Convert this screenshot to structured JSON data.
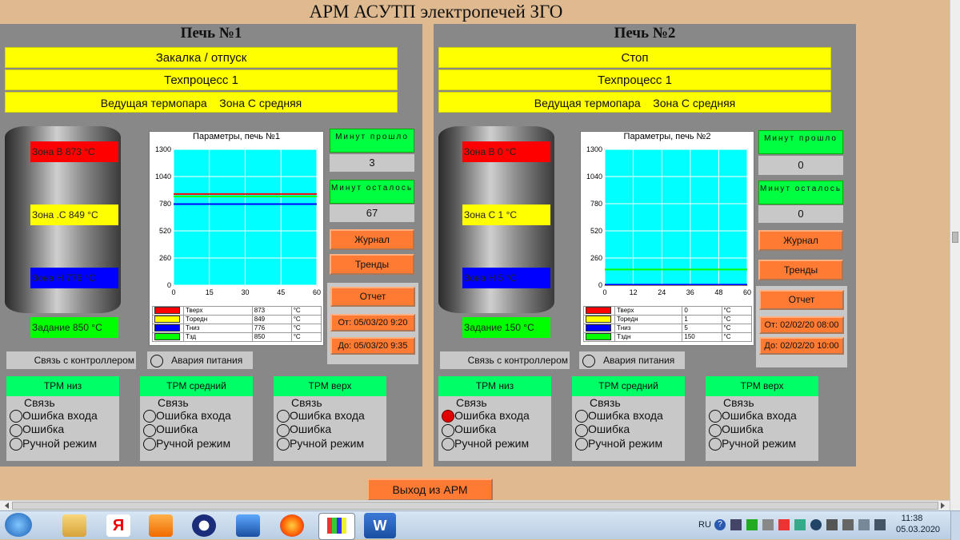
{
  "title": "АРМ АСУТП электропечей ЗГО",
  "furnace1": {
    "title": "Печь №1",
    "mode": "Закалка / отпуск",
    "process": "Техпроцесс 1",
    "thermocouple_label": "Ведущая термопара",
    "thermocouple_zone": "Зона С средняя",
    "zone_b": "Зона В   873 °С",
    "zone_c": "Зона .С   849 °С",
    "zone_n": "Зона Н   776 °С",
    "setpoint": "Задание   850 °С",
    "chart_title": "Параметры, печь №1",
    "minutes_passed_label": "Минут прошло",
    "minutes_passed": "3",
    "minutes_left_label": "Минут осталось",
    "minutes_left": "67",
    "journal": "Журнал",
    "trends": "Тренды",
    "report": "Отчет",
    "from": "От:  05/03/20 9:20",
    "to": "До:  05/03/20 9:35",
    "link": "Связь с контроллером",
    "power_alarm": "Авария питания",
    "legend": [
      {
        "name": "Тверх",
        "value": "873",
        "unit": "°С",
        "color": "#ff0000"
      },
      {
        "name": "Тoредн",
        "value": "849",
        "unit": "°С",
        "color": "#ffff00"
      },
      {
        "name": "Тниз",
        "value": "776",
        "unit": "°С",
        "color": "#0000ff"
      },
      {
        "name": "Тзд",
        "value": "850",
        "unit": "°С",
        "color": "#00ff00"
      }
    ]
  },
  "furnace2": {
    "title": "Печь №2",
    "mode": "Стоп",
    "process": "Техпроцесс 1",
    "thermocouple_label": "Ведущая термопара",
    "thermocouple_zone": "Зона С средняя",
    "zone_b": "Зона В   0 °С",
    "zone_c": "Зона С   1 °С",
    "zone_n": "Зона Н   5 °С",
    "setpoint": "Задание   150 °С",
    "chart_title": "Параметры, печь №2",
    "minutes_passed_label": "Минут прошло",
    "minutes_passed": "0",
    "minutes_left_label": "Минут осталось",
    "minutes_left": "0",
    "journal": "Журнал",
    "trends": "Тренды",
    "report": "Отчет",
    "from": "От:  02/02/20 08:00",
    "to": "До:  02/02/20 10:00",
    "link": "Связь с контроллером",
    "power_alarm": "Авария питания",
    "legend": [
      {
        "name": "Тверх",
        "value": "0",
        "unit": "°С",
        "color": "#ff0000"
      },
      {
        "name": "Торедн",
        "value": "1",
        "unit": "°С",
        "color": "#ffff00"
      },
      {
        "name": "Тниз",
        "value": "5",
        "unit": "°С",
        "color": "#0000ff"
      },
      {
        "name": "Тздн",
        "value": "150",
        "unit": "°С",
        "color": "#00ff00"
      }
    ]
  },
  "trm_labels": {
    "low": "ТРМ низ",
    "mid": "ТРМ средний",
    "top": "ТРМ верх",
    "link": "Связь",
    "input_error": "Ошибка входа",
    "error": "Ошибка",
    "manual": "Ручной режим"
  },
  "exit": "Выход из АРМ",
  "tray": {
    "lang": "RU",
    "time": "11:38",
    "date": "05.03.2020"
  },
  "chart_data": [
    {
      "type": "line",
      "title": "Параметры, печь №1",
      "x_ticks": [
        0,
        15,
        30,
        45,
        60
      ],
      "y_ticks": [
        0,
        260,
        520,
        780,
        1040,
        1300
      ],
      "xlim": [
        0,
        60
      ],
      "ylim": [
        0,
        1300
      ],
      "series": [
        {
          "name": "Тверх",
          "color": "#ff0000",
          "x": [
            0,
            60
          ],
          "y": [
            873,
            873
          ]
        },
        {
          "name": "Тoредн",
          "color": "#ffff00",
          "x": [
            0,
            60
          ],
          "y": [
            849,
            849
          ]
        },
        {
          "name": "Тниз",
          "color": "#0000ff",
          "x": [
            0,
            60
          ],
          "y": [
            776,
            776
          ]
        },
        {
          "name": "Тзд",
          "color": "#00ff00",
          "x": [
            0,
            60
          ],
          "y": [
            850,
            850
          ]
        }
      ]
    },
    {
      "type": "line",
      "title": "Параметры, печь №2",
      "x_ticks": [
        0,
        12,
        24,
        36,
        48,
        60
      ],
      "y_ticks": [
        0,
        260,
        520,
        780,
        1040,
        1300
      ],
      "xlim": [
        0,
        60
      ],
      "ylim": [
        0,
        1300
      ],
      "series": [
        {
          "name": "Тверх",
          "color": "#ff0000",
          "x": [
            0,
            60
          ],
          "y": [
            0,
            0
          ]
        },
        {
          "name": "Торедн",
          "color": "#ffff00",
          "x": [
            0,
            60
          ],
          "y": [
            1,
            1
          ]
        },
        {
          "name": "Тниз",
          "color": "#0000ff",
          "x": [
            0,
            60
          ],
          "y": [
            5,
            5
          ]
        },
        {
          "name": "Тздн",
          "color": "#00ff00",
          "x": [
            0,
            60
          ],
          "y": [
            150,
            150
          ]
        }
      ]
    }
  ]
}
